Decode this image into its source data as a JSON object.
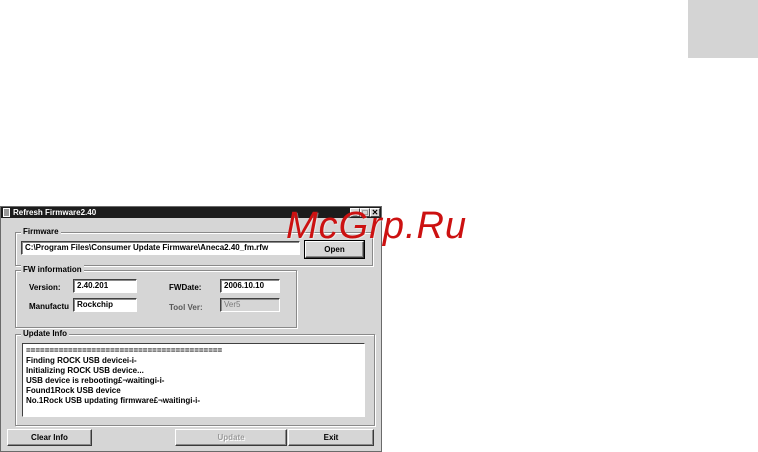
{
  "watermark": "McGrp.Ru",
  "window": {
    "title": "Refresh Firmware2.40",
    "controls": {
      "minimize": "_",
      "maximize": "□",
      "close": "✕"
    }
  },
  "firmware": {
    "legend": "Firmware",
    "path": "C:\\Program Files\\Consumer Update Firmware\\Aneca2.40_fm.rfw",
    "open_label": "Open"
  },
  "fw_info": {
    "legend": "FW information",
    "version_label": "Version:",
    "version_value": "2.40.201",
    "fwdate_label": "FWDate:",
    "fwdate_value": "2006.10.10",
    "manufacturer_label": "Manufactu",
    "manufacturer_value": "Rockchip",
    "toolver_label": "Tool Ver:",
    "toolver_value": "Ver5"
  },
  "update_info": {
    "legend": "Update Info",
    "lines": [
      "==========================================",
      "Finding ROCK USB devicei-i-",
      "Initializing ROCK USB device...",
      "USB device is rebooting£¬waitingi-i-",
      "Found1Rock USB device",
      "No.1Rock USB updating firmware£¬waitingi-i-"
    ]
  },
  "buttons": {
    "clear_info": "Clear Info",
    "update": "Update",
    "exit": "Exit"
  }
}
